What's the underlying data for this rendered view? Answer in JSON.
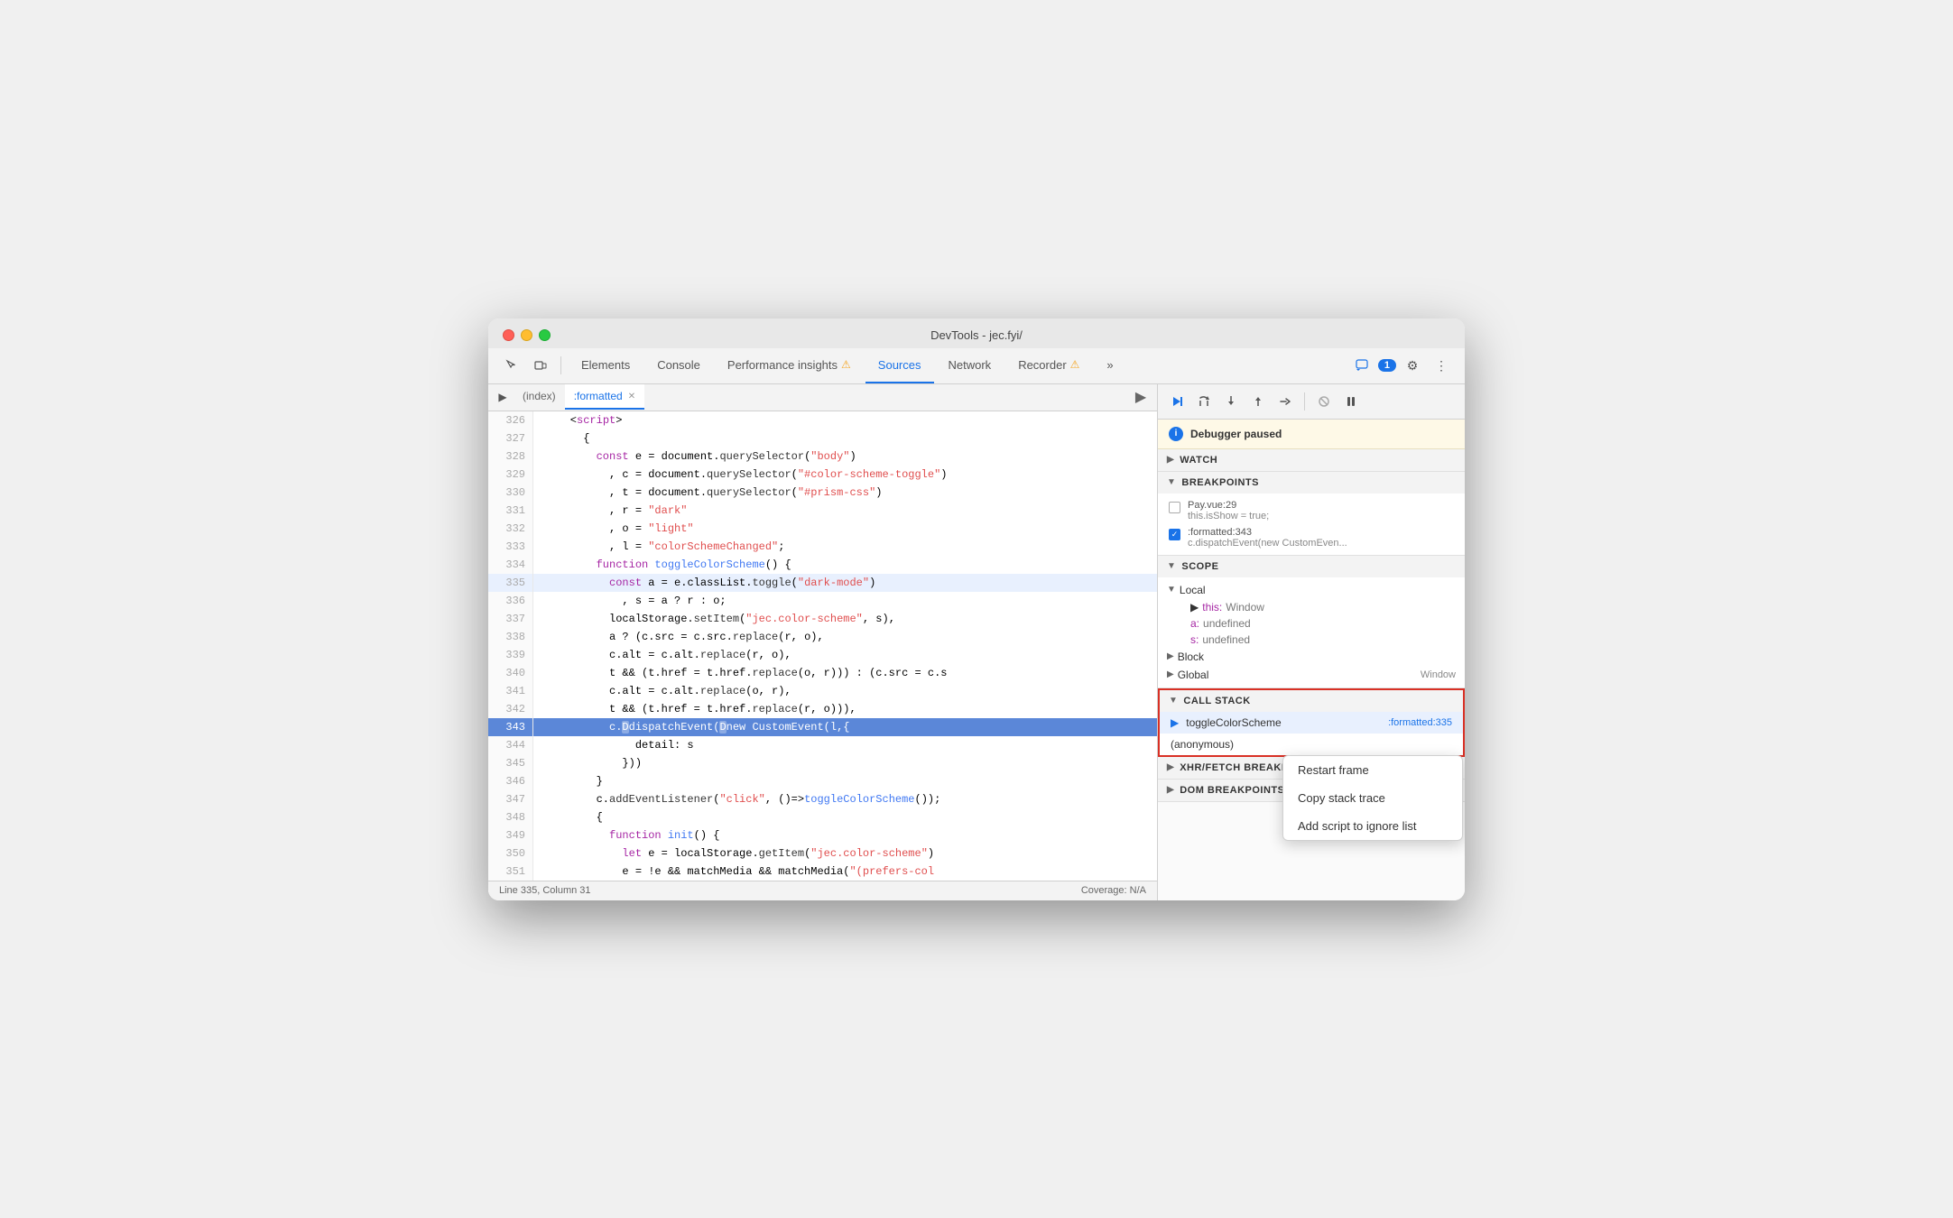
{
  "window": {
    "title": "DevTools - jec.fyi/"
  },
  "toolbar": {
    "tabs": [
      {
        "id": "elements",
        "label": "Elements",
        "active": false
      },
      {
        "id": "console",
        "label": "Console",
        "active": false
      },
      {
        "id": "performance",
        "label": "Performance insights",
        "active": false,
        "warning": true
      },
      {
        "id": "sources",
        "label": "Sources",
        "active": true
      },
      {
        "id": "network",
        "label": "Network",
        "active": false
      },
      {
        "id": "recorder",
        "label": "Recorder",
        "active": false,
        "warning": true
      }
    ],
    "more_tabs": "»",
    "badge": "1",
    "settings_icon": "⚙",
    "more_icon": "⋮"
  },
  "source_panel": {
    "file_tabs": [
      {
        "id": "index",
        "label": "(index)",
        "active": false
      },
      {
        "id": "formatted",
        "label": ":formatted",
        "active": true,
        "closeable": true
      }
    ],
    "code_lines": [
      {
        "num": 326,
        "content": "    <script>"
      },
      {
        "num": 327,
        "content": "      {"
      },
      {
        "num": 328,
        "content": "        const e = document.querySelector(\"body\")"
      },
      {
        "num": 329,
        "content": "          , c = document.querySelector(\"#color-scheme-toggle\")"
      },
      {
        "num": 330,
        "content": "          , t = document.querySelector(\"#prism-css\")"
      },
      {
        "num": 331,
        "content": "          , r = \"dark\""
      },
      {
        "num": 332,
        "content": "          , o = \"light\""
      },
      {
        "num": 333,
        "content": "          , l = \"colorSchemeChanged\";"
      },
      {
        "num": 334,
        "content": "        function toggleColorScheme() {"
      },
      {
        "num": 335,
        "content": "          const a = e.classList.toggle(\"dark-mode\")",
        "highlighted": true
      },
      {
        "num": 336,
        "content": "            , s = a ? r : o;"
      },
      {
        "num": 337,
        "content": "          localStorage.setItem(\"jec.color-scheme\", s),"
      },
      {
        "num": 338,
        "content": "          a ? (c.src = c.src.replace(r, o),"
      },
      {
        "num": 339,
        "content": "          c.alt = c.alt.replace(r, o),"
      },
      {
        "num": 340,
        "content": "          t && (t.href = t.href.replace(o, r))) : (c.src = c.s"
      },
      {
        "num": 341,
        "content": "          c.alt = c.alt.replace(o, r),"
      },
      {
        "num": 342,
        "content": "          t && (t.href = t.href.replace(r, o))),"
      },
      {
        "num": 343,
        "content": "          c.dispatchEvent(new CustomEvent(l,{",
        "current": true
      },
      {
        "num": 344,
        "content": "              detail: s"
      },
      {
        "num": 345,
        "content": "            }))"
      },
      {
        "num": 346,
        "content": "        }"
      },
      {
        "num": 347,
        "content": "        c.addEventListener(\"click\", ()=>toggleColorScheme());"
      },
      {
        "num": 348,
        "content": "        {"
      },
      {
        "num": 349,
        "content": "          function init() {"
      },
      {
        "num": 350,
        "content": "            let e = localStorage.getItem(\"jec.color-scheme\")"
      },
      {
        "num": 351,
        "content": "            e = !e && matchMedia && matchMedia(\"(prefers-col"
      }
    ],
    "status_left": "Line 335, Column 31",
    "status_right": "Coverage: N/A"
  },
  "debugger": {
    "paused_text": "Debugger paused",
    "watch_label": "Watch",
    "breakpoints_label": "Breakpoints",
    "breakpoints": [
      {
        "id": "bp1",
        "checked": false,
        "file": "Pay.vue:29",
        "code": "this.isShow = true;"
      },
      {
        "id": "bp2",
        "checked": true,
        "file": ":formatted:343",
        "code": "c.dispatchEvent(new CustomEven..."
      }
    ],
    "scope_label": "Scope",
    "local_label": "Local",
    "scope_items": [
      {
        "key": "this:",
        "val": "Window"
      },
      {
        "key": "a:",
        "val": "undefined"
      },
      {
        "key": "s:",
        "val": "undefined"
      }
    ],
    "block_label": "Block",
    "global_label": "Global",
    "global_val": "Window",
    "call_stack_label": "Call stack",
    "call_stack_items": [
      {
        "fn": "toggleColorScheme",
        "loc": ":formatted:335",
        "active": true
      },
      {
        "fn": "(anonymous)",
        "loc": ""
      }
    ],
    "xhr_label": "XHR/fetch breakpoints",
    "dom_label": "DOM breakpoints"
  },
  "context_menu": {
    "items": [
      {
        "id": "restart-frame",
        "label": "Restart frame"
      },
      {
        "id": "copy-stack-trace",
        "label": "Copy stack trace"
      },
      {
        "id": "add-script-ignore",
        "label": "Add script to ignore list"
      }
    ]
  }
}
